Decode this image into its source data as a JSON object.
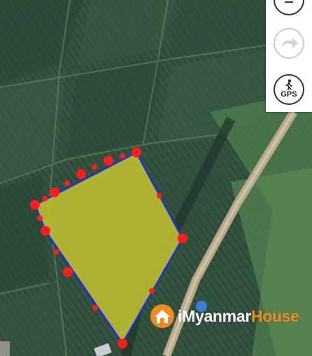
{
  "map": {
    "type": "satellite",
    "polygon_fill": "#c6c430",
    "polygon_stroke": "#1f2fe0",
    "vertex_color": "#ff1e1e"
  },
  "toolbar": {
    "buttons": [
      {
        "name": "undo",
        "icon": "undo-icon",
        "enabled": true
      },
      {
        "name": "redo",
        "icon": "redo-icon",
        "enabled": false
      },
      {
        "name": "gps",
        "icon": "walking-person-icon",
        "label": "GPS",
        "enabled": true
      }
    ]
  },
  "watermark": {
    "text_a": "iMyanmar",
    "text_b": "House",
    "icon": "house-logo-icon"
  }
}
